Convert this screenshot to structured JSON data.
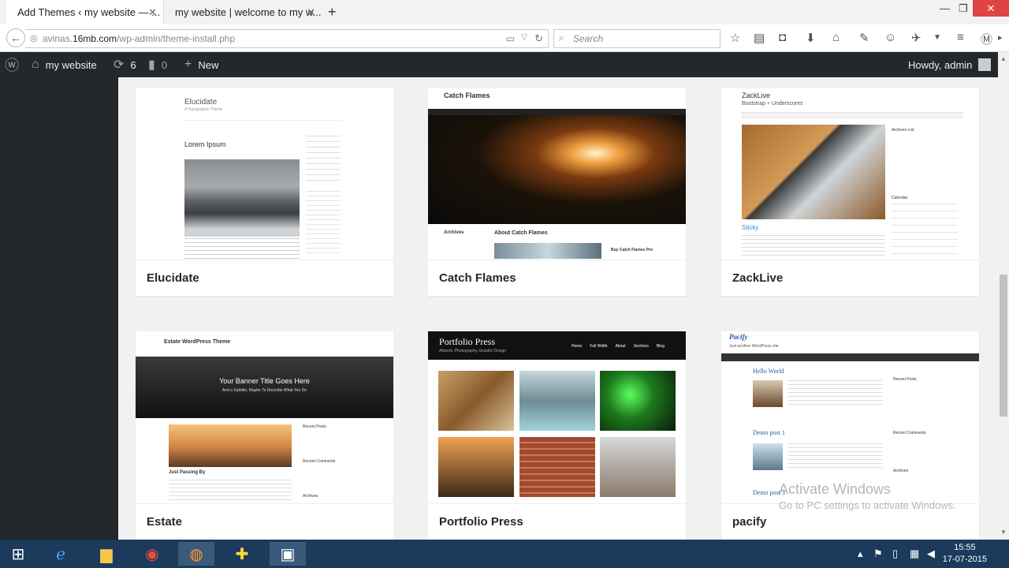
{
  "browser": {
    "tabs": [
      {
        "label": "Add Themes ‹ my website — ..."
      },
      {
        "label": "my website | welcome to my w..."
      }
    ],
    "new_tab": "+",
    "url_domain_prefix": "avinas.",
    "url_domain": "16mb.com",
    "url_path": "/wp-admin/theme-install.php",
    "search_placeholder": "Search"
  },
  "adminbar": {
    "site_name": "my website",
    "updates_count": "6",
    "comments_count": "0",
    "new_label": "New",
    "howdy": "Howdy, admin"
  },
  "themes": [
    {
      "name": "Elucidate",
      "preview_title": "Elucidate",
      "preview_subtitle": "A Typographic Theme",
      "post_title": "Lorem Ipsum"
    },
    {
      "name": "Catch Flames",
      "preview_title": "Catch Flames",
      "about": "About Catch Flames",
      "archives": "Archives",
      "buy": "Buy Catch Flames Pro"
    },
    {
      "name": "ZackLive",
      "preview_title": "ZackLive",
      "preview_subtitle": "Bootstrap + Underscores",
      "post_title": "Sticky",
      "archives": "Archives List",
      "calendar": "Calendar"
    },
    {
      "name": "Estate",
      "preview_title": "Estate WordPress Theme",
      "banner_title": "Your Banner Title Goes Here",
      "banner_sub": "And a Subtitle, Maybe To Describe What You Do",
      "post_title": "Just Passing By",
      "recent_posts": "Recent Posts",
      "recent_comments": "Recent Comments",
      "archives": "Archives"
    },
    {
      "name": "Portfolio Press",
      "preview_title": "Portfolio Press",
      "preview_subtitle": "Artwork, Photography, Graphic Design",
      "nav": [
        "Home",
        "Full Width",
        "About",
        "Sections",
        "Blog"
      ]
    },
    {
      "name": "pacify",
      "preview_title": "Pacify",
      "preview_subtitle": "Just another WordPress site",
      "posts": [
        "Hello World",
        "Demo post 1",
        "Demo post 3"
      ],
      "recent_posts": "Recent Posts",
      "recent_comments": "Recent Comments",
      "archives": "Archives"
    }
  ],
  "watermark": {
    "line1": "Activate Windows",
    "line2": "Go to PC settings to activate Windows."
  },
  "taskbar": {
    "time": "15:55",
    "date": "17-07-2015"
  }
}
